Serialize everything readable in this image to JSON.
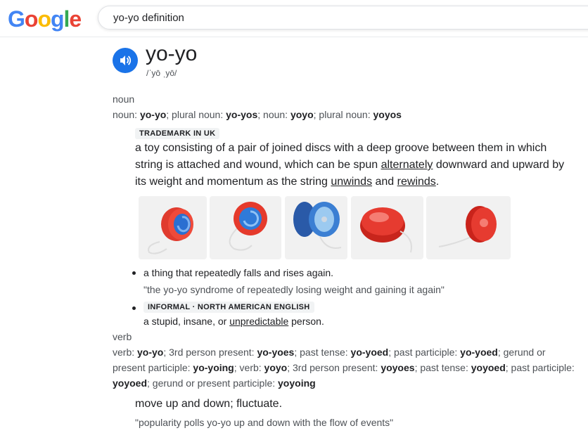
{
  "header": {
    "logo": [
      "G",
      "o",
      "o",
      "g",
      "l",
      "e"
    ],
    "logo_colors": [
      "#4285F4",
      "#EA4335",
      "#FBBC05",
      "#4285F4",
      "#34A853",
      "#EA4335"
    ],
    "search_query": "yo-yo definition"
  },
  "entry": {
    "word": "yo-yo",
    "phonetic": "/ˈyō ˌyō/",
    "speaker_icon": "speaker-icon"
  },
  "noun": {
    "pos": "noun",
    "forms": [
      {
        "label": "noun: ",
        "value": "yo-yo"
      },
      {
        "label": "; plural noun: ",
        "value": "yo-yos"
      },
      {
        "label": "; noun: ",
        "value": "yoyo"
      },
      {
        "label": "; plural noun: ",
        "value": "yoyos"
      }
    ],
    "trademark_tag": "TRADEMARK IN UK",
    "definition": {
      "p1": "a toy consisting of a pair of joined discs with a deep groove between them in which string is attached and wound, which can be spun ",
      "link1": "alternately",
      "p2": " downward and upward by its weight and momentum as the string ",
      "link2": "unwinds",
      "p3": " and ",
      "link3": "rewinds",
      "p4": "."
    },
    "sense2": {
      "text": "a thing that repeatedly falls and rises again.",
      "example": "\"the yo-yo syndrome of repeatedly losing weight and gaining it again\""
    },
    "sense3": {
      "tag": "INFORMAL · NORTH AMERICAN ENGLISH",
      "text_before": "a stupid, insane, or ",
      "link": "unpredictable",
      "text_after": " person."
    }
  },
  "verb": {
    "pos": "verb",
    "line1": [
      {
        "label": "verb: ",
        "value": "yo-yo"
      },
      {
        "label": "; 3rd person present: ",
        "value": "yo-yoes"
      },
      {
        "label": "; past tense: ",
        "value": "yo-yoed"
      },
      {
        "label": "; past participle: ",
        "value": "yo-yoed"
      },
      {
        "label": "; gerund or",
        "value": ""
      }
    ],
    "line2": [
      {
        "label": "present participle: ",
        "value": "yo-yoing"
      },
      {
        "label": "; verb: ",
        "value": "yoyo"
      },
      {
        "label": "; 3rd person present: ",
        "value": "yoyoes"
      },
      {
        "label": "; past tense: ",
        "value": "yoyoed"
      },
      {
        "label": "; past participle:",
        "value": ""
      }
    ],
    "line3": [
      {
        "label": "",
        "value": "yoyoed"
      },
      {
        "label": "; gerund or present participle: ",
        "value": "yoyoing"
      }
    ],
    "definition": "move up and down; fluctuate.",
    "example": "\"popularity polls yo-yo up and down with the flow of events\""
  }
}
